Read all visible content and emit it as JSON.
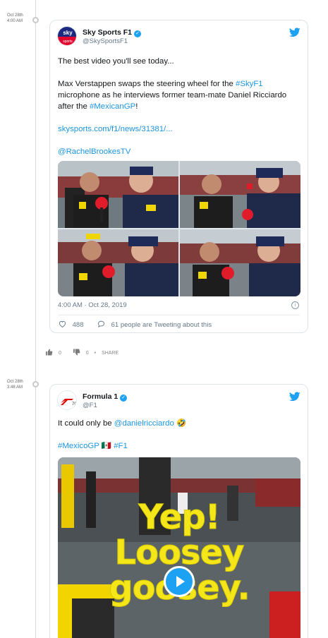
{
  "posts": [
    {
      "date": "Oct 28th",
      "time": "4:00 AM",
      "author": {
        "name": "Sky Sports F1",
        "handle": "@SkySportsF1"
      },
      "text": {
        "p1": "The best video you'll see today...",
        "p2_a": "Max Verstappen swaps the steering wheel for the ",
        "p2_tag1": "#SkyF1",
        "p2_b": " microphone as he interviews former team-mate Daniel Ricciardo after the ",
        "p2_tag2": "#MexicanGP",
        "p2_c": "!",
        "link": "skysports.com/f1/news/31381/...",
        "mention": "@RachelBrookesTV"
      },
      "timestamp": "4:00 AM · Oct 28, 2019",
      "likes": "488",
      "conversation": "61 people are Tweeting about this",
      "social": {
        "like_count": "0",
        "dislike_count": "0",
        "share_label": "SHARE"
      }
    },
    {
      "date": "Oct 28th",
      "time": "3:48 AM",
      "author": {
        "name": "Formula 1",
        "handle": "@F1"
      },
      "text": {
        "line1_a": "It could only be ",
        "line1_mention": "@danielricciardo",
        "line1_emoji": "🤣",
        "tag1": "#MexicoGP",
        "flag": "🇲🇽",
        "tag2": "#F1"
      },
      "video_overlay": {
        "line1": "Yep!",
        "line2": "Loosey",
        "line3": "goosey."
      }
    }
  ],
  "colors": {
    "link": "#1b95e0",
    "twitter_blue": "#1da1f2",
    "overlay_yellow": "#f5e61a"
  },
  "icons": [
    "twitter-bird-icon",
    "verified-icon",
    "info-icon",
    "heart-icon",
    "comment-icon",
    "thumbs-up-icon",
    "thumbs-down-icon",
    "play-icon"
  ]
}
